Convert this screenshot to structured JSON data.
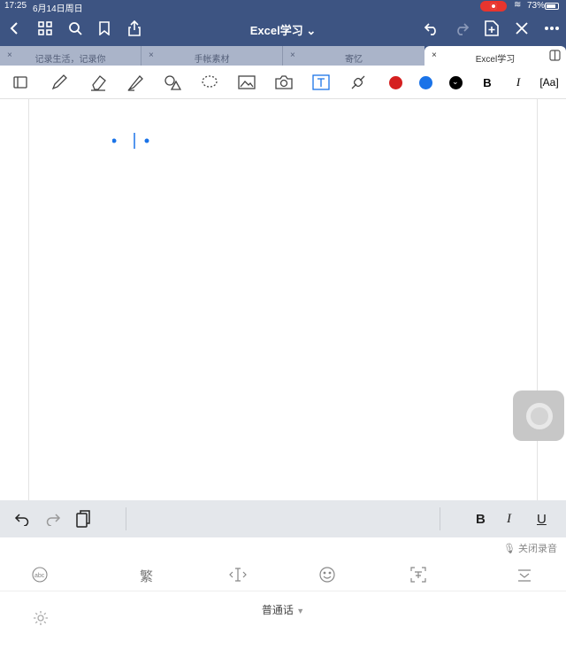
{
  "status": {
    "time": "17:25",
    "date": "6月14日周日",
    "battery": "73%"
  },
  "nav": {
    "title": "Excel学习"
  },
  "tabs": [
    {
      "label": "记录生活，记录你"
    },
    {
      "label": "手帐素材"
    },
    {
      "label": "寄忆"
    },
    {
      "label": "Excel学习"
    }
  ],
  "toolbar": {
    "colors": {
      "red": "#d51f1f",
      "blue": "#1a73e8",
      "black": "#000000"
    },
    "bold": "B",
    "italic": "I",
    "text_style": "[Aa]"
  },
  "keyboard_bar": {
    "bold": "B",
    "italic": "I",
    "underline": "U"
  },
  "keyboard": {
    "voice_off": "关闭录音",
    "traditional": "繁",
    "language": "普通话"
  }
}
